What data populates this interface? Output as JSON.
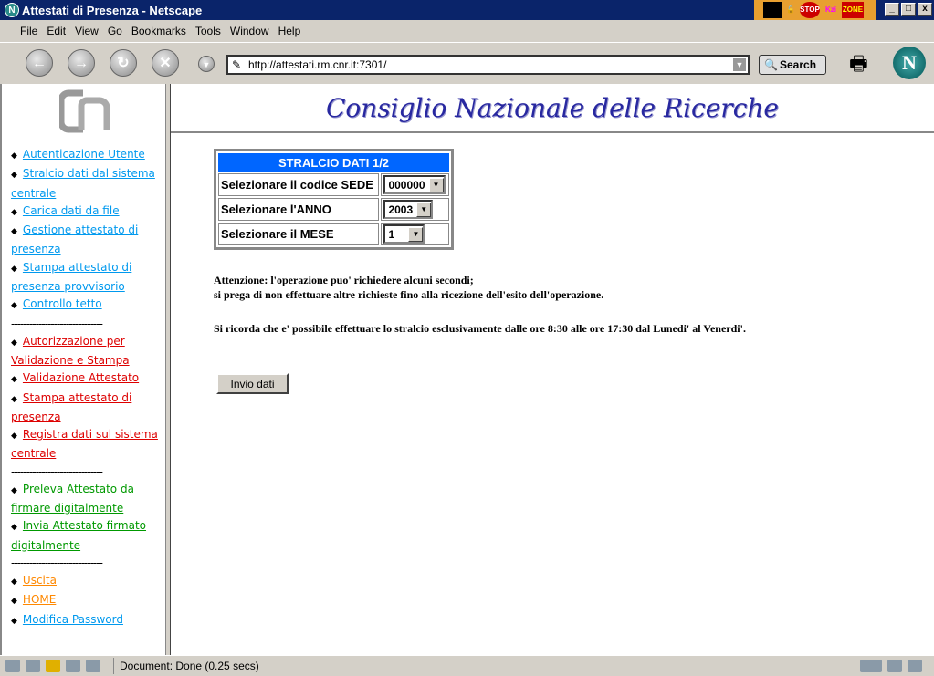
{
  "window": {
    "title": "Attestati di Presenza - Netscape",
    "tray": [
      "STOP",
      "Kzi",
      "ZONE"
    ]
  },
  "menu": [
    "File",
    "Edit",
    "View",
    "Go",
    "Bookmarks",
    "Tools",
    "Window",
    "Help"
  ],
  "toolbar": {
    "url": "http://attestati.rm.cnr.it:7301/",
    "search_label": "Search"
  },
  "sidebar": {
    "groups": [
      {
        "color": "blue",
        "items": [
          "Autenticazione Utente",
          "Stralcio dati dal sistema centrale",
          "Carica dati da file",
          "Gestione attestato di presenza",
          "Stampa attestato di presenza provvisorio",
          "Controllo tetto"
        ]
      },
      {
        "color": "red",
        "items": [
          "Autorizzazione per Validazione e Stampa",
          "Validazione Attestato",
          "Stampa attestato di presenza",
          "Registra dati sul sistema centrale"
        ]
      },
      {
        "color": "green",
        "items": [
          "Preleva Attestato da firmare digitalmente",
          "Invia Attestato firmato digitalmente"
        ]
      },
      {
        "color": "mixed",
        "items": [
          "Uscita",
          "HOME",
          "Modifica Password"
        ]
      }
    ],
    "separator": "------------------------------"
  },
  "header": {
    "title": "Consiglio Nazionale delle Ricerche"
  },
  "form": {
    "title": "STRALCIO DATI 1/2",
    "rows": [
      {
        "label": "Selezionare il codice SEDE",
        "value": "000000"
      },
      {
        "label": "Selezionare l'ANNO",
        "value": "2003"
      },
      {
        "label": "Selezionare il MESE",
        "value": "1"
      }
    ],
    "submit": "Invio dati"
  },
  "messages": {
    "line1": "Attenzione: l'operazione puo' richiedere alcuni secondi;",
    "line2": "si prega di non effettuare altre richieste fino alla ricezione dell'esito dell'operazione.",
    "line3": "Si ricorda che e' possibile effettuare lo stralcio esclusivamente dalle ore 8:30 alle ore 17:30 dal Lunedi' al Venerdi'."
  },
  "status": {
    "text": "Document: Done (0.25 secs)"
  }
}
